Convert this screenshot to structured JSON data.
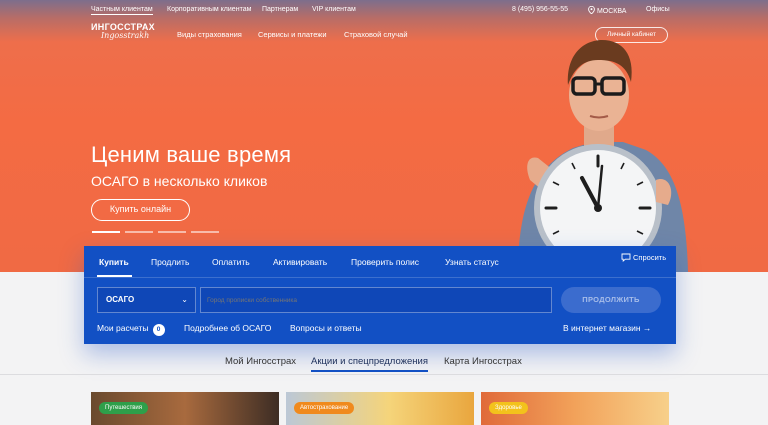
{
  "topbar": {
    "segments": [
      "Частным клиентам",
      "Корпоративным клиентам",
      "Партнерам",
      "VIP клиентам"
    ],
    "phone": "8 (495) 956-55-55",
    "city": "МОСКВА",
    "offices": "Офисы"
  },
  "logo": {
    "line1": "ИНГОССТРАХ",
    "line2": "Ingosstrakh"
  },
  "mainnav": [
    "Виды страхования",
    "Сервисы и платежи",
    "Страховой случай"
  ],
  "cabinet_label": "Личный кабинет",
  "hero": {
    "title": "Ценим ваше время",
    "subtitle": "ОСАГО в несколько кликов",
    "button": "Купить онлайн"
  },
  "panel": {
    "tabs": [
      "Купить",
      "Продлить",
      "Оплатить",
      "Активировать",
      "Проверить полис",
      "Узнать статус"
    ],
    "active_tab": "Купить",
    "ask": "Спросить",
    "product_select": "ОСАГО",
    "city_placeholder": "Город прописки собственника",
    "continue": "ПРОДОЛЖИТЬ",
    "my_calcs": "Мои расчеты",
    "my_calcs_count": "0",
    "about": "Подробнее об ОСАГО",
    "faq": "Вопросы и ответы",
    "shop": "В интернет магазин →"
  },
  "subnav": [
    "Мой Ингосстрах",
    "Акции и спецпредложения",
    "Карта Ингосстрах"
  ],
  "subnav_active": "Акции и спецпредложения",
  "cards": [
    {
      "tag": "Путешествия",
      "tag_color": "#2e9f4a"
    },
    {
      "tag": "Автострахование",
      "tag_color": "#f08a1d"
    },
    {
      "tag": "Здоровье",
      "tag_color": "#f3c21c"
    }
  ],
  "colors": {
    "hero_orange": "#f46b43",
    "panel_blue": "#1250c4"
  }
}
